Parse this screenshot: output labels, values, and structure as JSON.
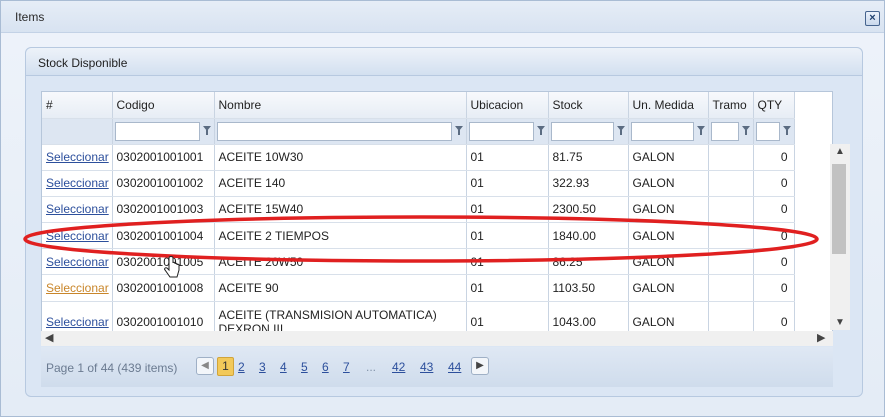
{
  "window": {
    "title": "Items",
    "close_icon": "close-icon"
  },
  "panel": {
    "title": "Stock Disponible"
  },
  "grid": {
    "columns": [
      "#",
      "Codigo",
      "Nombre",
      "Ubicacion",
      "Stock",
      "Un. Medida",
      "Tramo",
      "QTY"
    ],
    "rows": [
      {
        "action": "Seleccionar",
        "codigo": "0302001001001",
        "nombre": "ACEITE 10W30",
        "ubicacion": "01",
        "stock": "81.75",
        "medida": "GALON",
        "tramo": "",
        "qty": "0"
      },
      {
        "action": "Seleccionar",
        "codigo": "0302001001002",
        "nombre": "ACEITE 140",
        "ubicacion": "01",
        "stock": "322.93",
        "medida": "GALON",
        "tramo": "",
        "qty": "0"
      },
      {
        "action": "Seleccionar",
        "codigo": "0302001001003",
        "nombre": "ACEITE 15W40",
        "ubicacion": "01",
        "stock": "2300.50",
        "medida": "GALON",
        "tramo": "",
        "qty": "0"
      },
      {
        "action": "Seleccionar",
        "codigo": "0302001001004",
        "nombre": "ACEITE 2 TIEMPOS",
        "ubicacion": "01",
        "stock": "1840.00",
        "medida": "GALON",
        "tramo": "",
        "qty": "0"
      },
      {
        "action": "Seleccionar",
        "codigo": "0302001001005",
        "nombre": "ACEITE 20W50",
        "ubicacion": "01",
        "stock": "86.25",
        "medida": "GALON",
        "tramo": "",
        "qty": "0"
      },
      {
        "action": "Seleccionar",
        "codigo": "0302001001008",
        "nombre": "ACEITE 90",
        "ubicacion": "01",
        "stock": "1103.50",
        "medida": "GALON",
        "tramo": "",
        "qty": "0"
      },
      {
        "action": "Seleccionar",
        "codigo": "0302001001010",
        "nombre": "ACEITE (TRANSMISION AUTOMATICA) DEXRON III",
        "ubicacion": "01",
        "stock": "1043.00",
        "medida": "GALON",
        "tramo": "",
        "qty": "0"
      }
    ]
  },
  "pager": {
    "info": "Page 1 of 44 (439 items)",
    "pages": [
      "1",
      "2",
      "3",
      "4",
      "5",
      "6",
      "7"
    ],
    "ellipsis": "...",
    "last_pages": [
      "42",
      "43",
      "44"
    ],
    "current": "1"
  },
  "colors": {
    "link": "#2c4f9c",
    "visited_link": "#c9862a",
    "highlight_ellipse": "#e02020",
    "current_page": "#f2c95a"
  }
}
